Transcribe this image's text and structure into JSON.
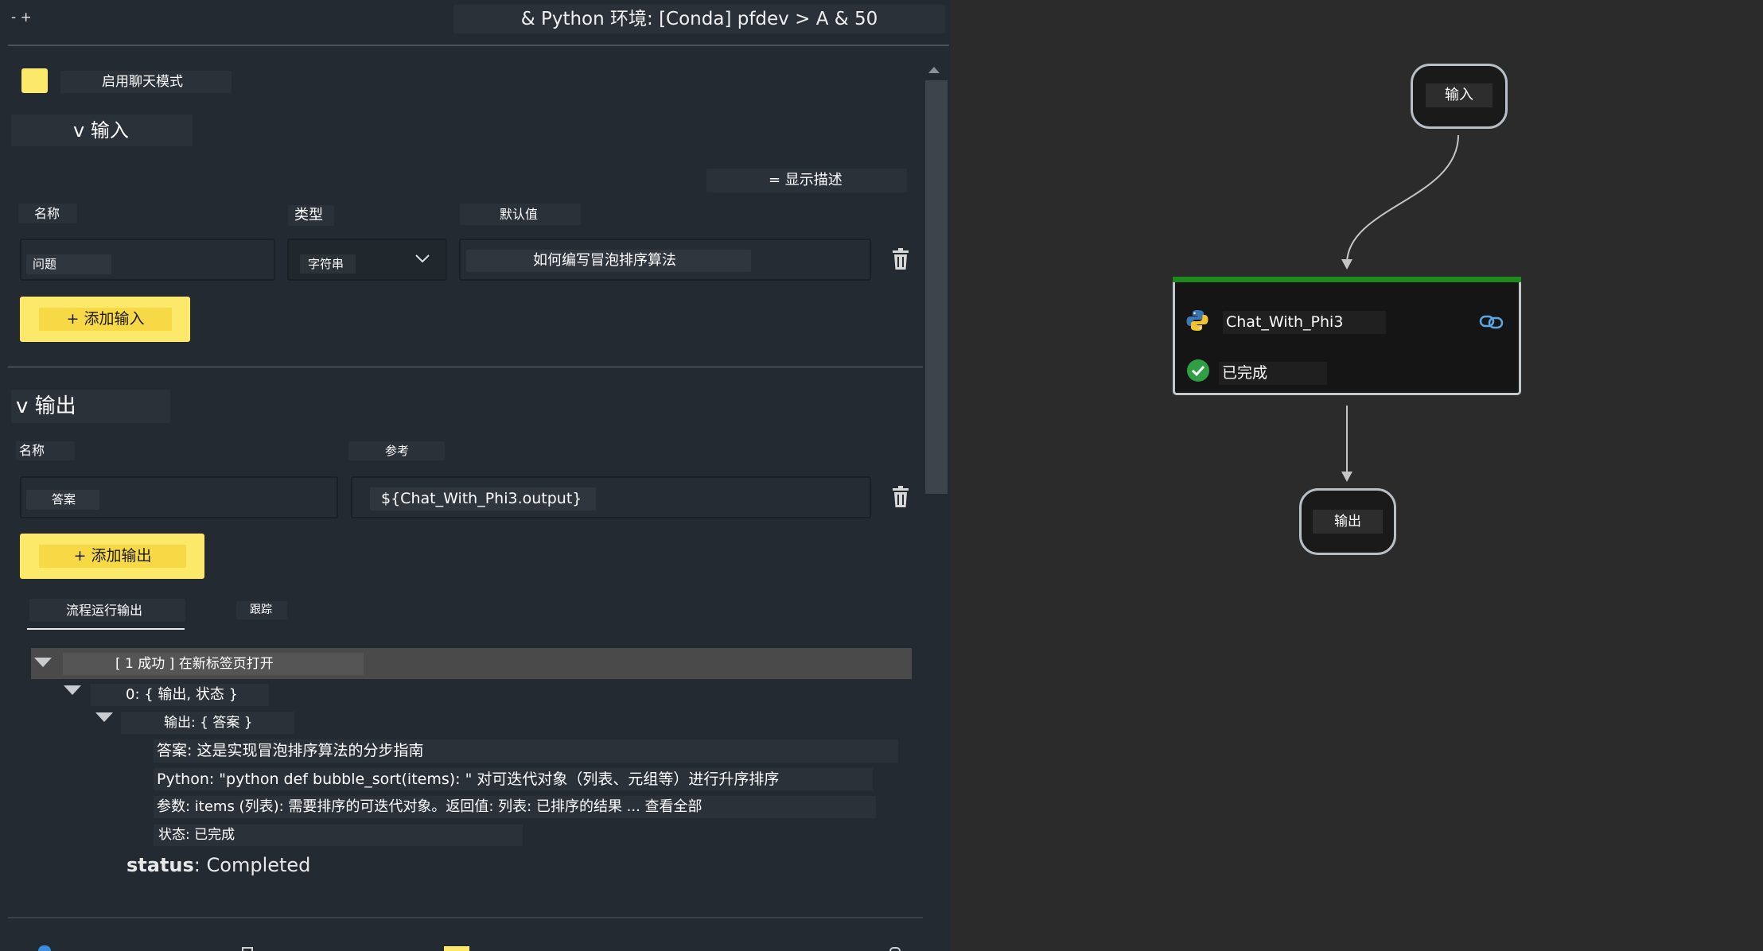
{
  "window": {
    "corner_controls": "- +",
    "title": "& Python 环境: [Conda] pfdev > A & 50"
  },
  "chat_mode": {
    "label": "启用聊天模式",
    "accent": "#fce96a"
  },
  "inputs": {
    "section_title": "v 输入",
    "show_desc_label": "= 显示描述",
    "headers": {
      "name": "名称",
      "type": "类型",
      "default": "默认值"
    },
    "row": {
      "name": "问题",
      "type": "字符串",
      "default": "如何编写冒泡排序算法"
    },
    "add_label": "+ 添加输入"
  },
  "outputs": {
    "section_title": "v 输出",
    "headers": {
      "name": "名称",
      "reference": "参考"
    },
    "row": {
      "name": "答案",
      "reference": "${Chat_With_Phi3.output}"
    },
    "add_label": "+ 添加输出"
  },
  "tabs": [
    {
      "label": "流程运行输出",
      "active": true
    },
    {
      "label": "跟踪",
      "active": false
    }
  ],
  "run_output": {
    "root": "[ 1 成功 ] 在新标签页打开",
    "item0": "0: { 输出, 状态 }",
    "output_node": "输出: { 答案 }",
    "lines": [
      "答案: 这是实现冒泡排序算法的分步指南",
      "Python: \"python def bubble_sort(items): \" 对可迭代对象（列表、元组等）进行升序排序",
      "参数: items (列表): 需要排序的可迭代对象。返回值: 列表: 已排序的结果 ... 查看全部",
      "状态: 已完成"
    ],
    "status_key": "status",
    "status_value": ": Completed"
  },
  "flow": {
    "input_node": "输入",
    "main_node": {
      "name": "Chat_With_Phi3",
      "status": "已完成",
      "status_color": "#2e7d32",
      "bar_color": "#1e8a1e"
    },
    "output_node": "输出"
  },
  "icons": {
    "trash": "trash-icon",
    "dropdown": "chevron-down-icon",
    "python": "python-icon",
    "link": "link-icon",
    "check": "check-circle-icon"
  }
}
